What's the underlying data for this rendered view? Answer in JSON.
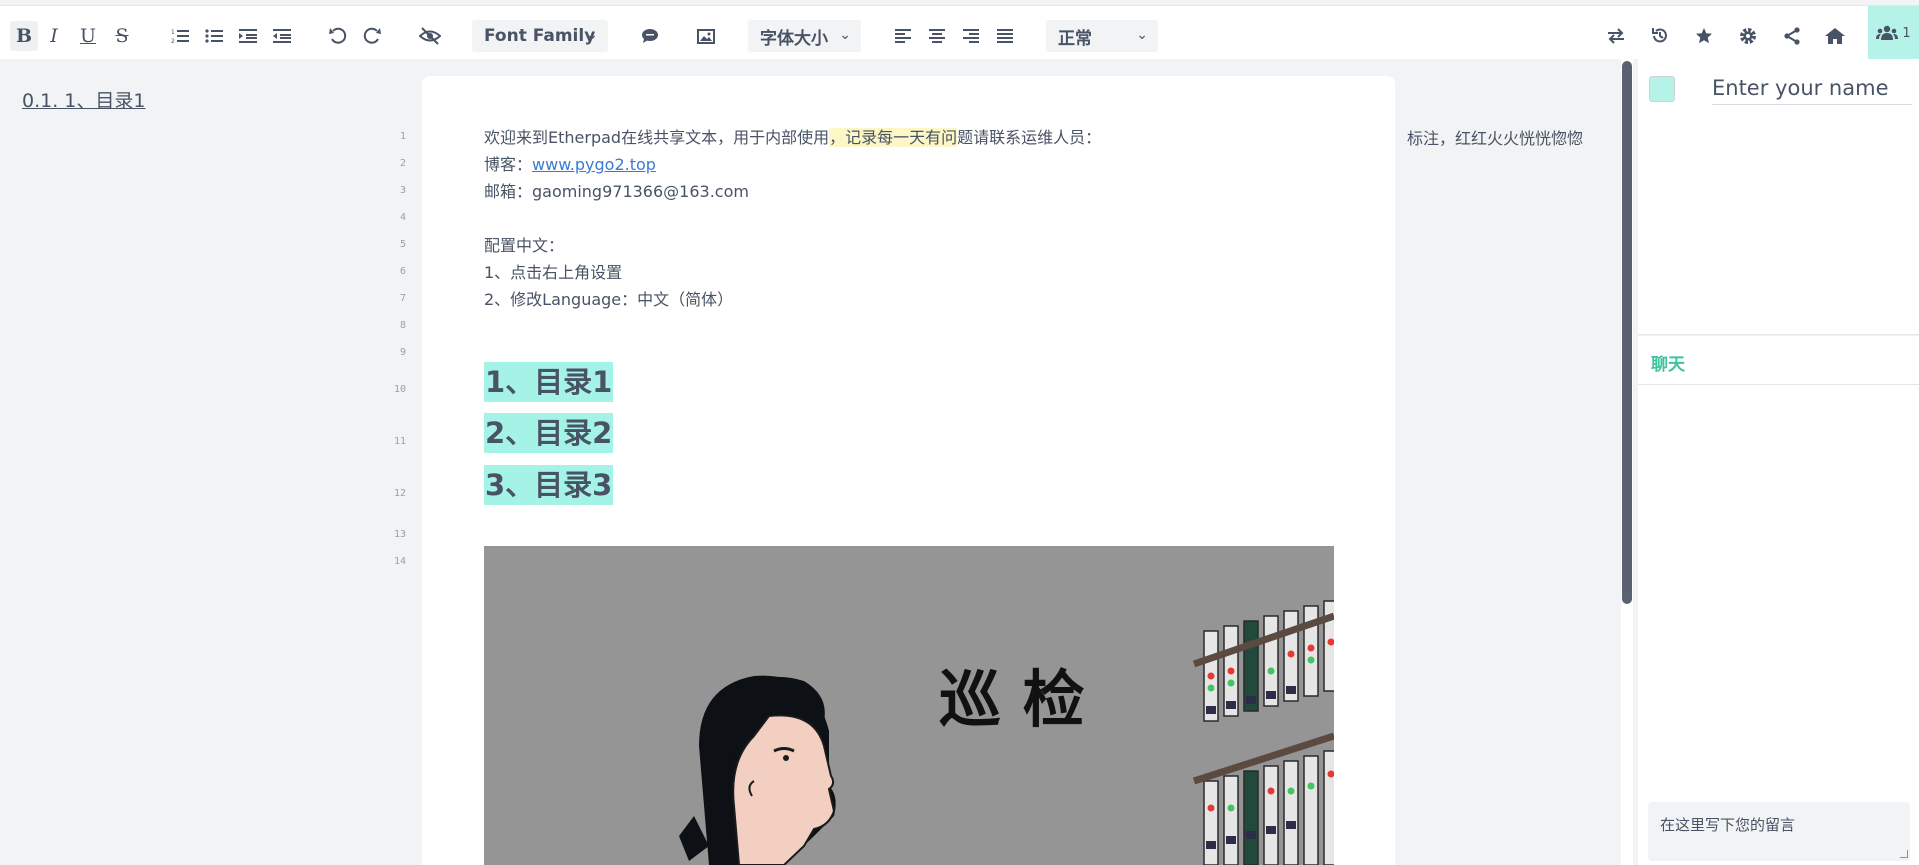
{
  "toolbar": {
    "bold_label": "B",
    "italic_label": "I",
    "underline_label": "U",
    "strike_label": "S",
    "font_family": "Font Family",
    "font_size": "字体大小",
    "paragraph_style": "正常",
    "user_count": "1",
    "icons": [
      "bold-icon",
      "italic-icon",
      "underline-icon",
      "strikethrough-icon",
      "ordered-list-icon",
      "unordered-list-icon",
      "indent-icon",
      "outdent-icon",
      "undo-icon",
      "redo-icon",
      "clear-authorship-icon",
      "comment-icon",
      "image-icon",
      "align-left-icon",
      "align-center-icon",
      "align-right-icon",
      "align-justify-icon",
      "import-export-icon",
      "history-icon",
      "star-icon",
      "settings-icon",
      "share-icon",
      "home-icon",
      "users-icon"
    ]
  },
  "toc": {
    "entry": "0.1. 1、目录1"
  },
  "editor": {
    "line_numbers": [
      "1",
      "2",
      "3",
      "4",
      "5",
      "6",
      "7",
      "8",
      "9",
      "10",
      "11",
      "12",
      "13",
      "14"
    ],
    "line1_a": "欢迎来到Etherpad在线共享文本，用于内部使用",
    "line1_b": "，记录每一天有问",
    "line1_c": "题请联系运维人员：",
    "line2_label": "博客：",
    "line2_link": "www.pygo2.top",
    "line3": "邮箱：gaoming971366@163.com",
    "line5": "配置中文：",
    "line6": "1、点击右上角设置",
    "line7": "2、修改Language：中文（简体）",
    "headings": [
      "1、目录1",
      "2、目录2",
      "3、目录3"
    ],
    "image_caption": "巡 检"
  },
  "comment": {
    "text": "标注，红红火火恍恍惚惚"
  },
  "users_panel": {
    "name_placeholder": "Enter your name",
    "swatch_color": "#b5f3e8"
  },
  "chat": {
    "title": "聊天",
    "input_placeholder": "在这里写下您的留言",
    "title_color": "#3ec39d"
  },
  "colors": {
    "accent": "#b5f3e8",
    "highlight": "#fdf6c7",
    "heading_bg": "#a5f3e6",
    "link": "#3a7bd5"
  }
}
